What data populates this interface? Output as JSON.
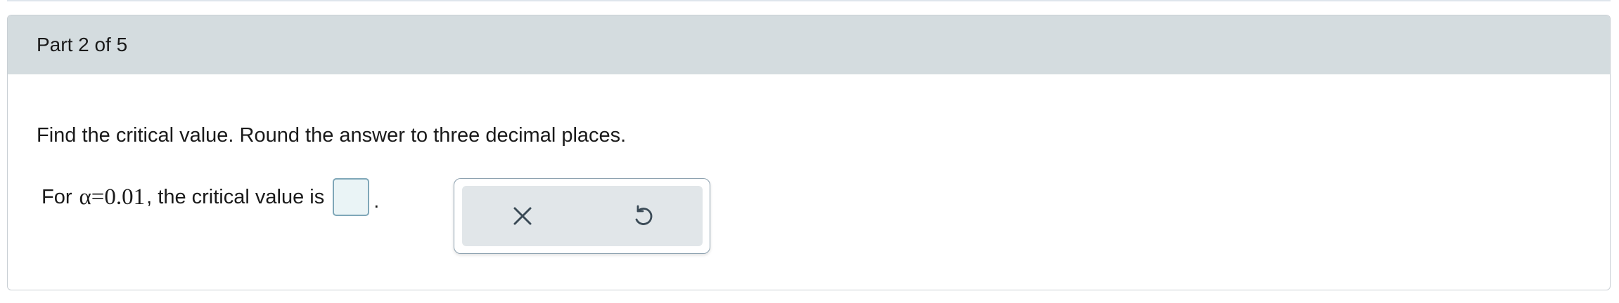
{
  "part": {
    "label": "Part 2 of 5"
  },
  "question": {
    "instruction": "Find the critical value. Round the answer to three decimal places.",
    "lead_text": "For ",
    "math_expression": "α=0.01",
    "trail_text": ", the critical value is",
    "answer_value": "",
    "period": "."
  },
  "toolbar": {
    "clear_icon": "x-icon",
    "undo_icon": "undo-icon"
  }
}
